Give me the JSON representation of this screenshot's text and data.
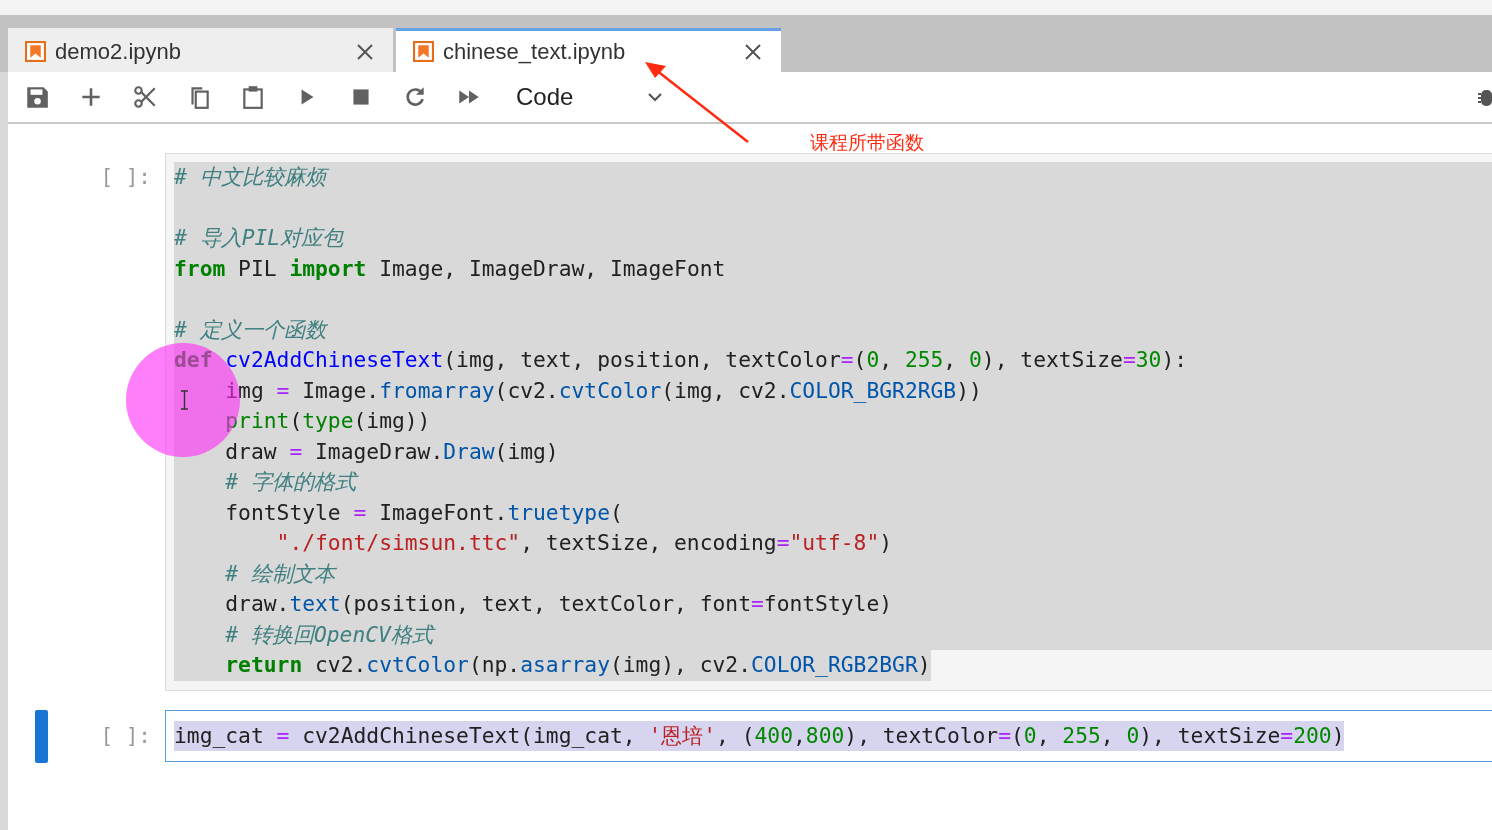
{
  "tabs": [
    {
      "label": "demo2.ipynb",
      "selected": false
    },
    {
      "label": "chinese_text.ipynb",
      "selected": true
    }
  ],
  "toolbar": {
    "cell_type": "Code"
  },
  "annotation": {
    "text": "课程所带函数"
  },
  "cells": [
    {
      "prompt": "[ ]:",
      "active": false,
      "selected": true,
      "lines": [
        {
          "kind": "code",
          "tokens": [
            {
              "kind": "comment",
              "text": "# 中文比较麻烦"
            }
          ]
        },
        {
          "kind": "blank"
        },
        {
          "kind": "code",
          "tokens": [
            {
              "kind": "comment",
              "text": "# 导入PIL对应包"
            }
          ]
        },
        {
          "kind": "code",
          "tokens": [
            {
              "kind": "keyword",
              "text": "from"
            },
            {
              "kind": "plain",
              "text": " PIL "
            },
            {
              "kind": "keyword",
              "text": "import"
            },
            {
              "kind": "plain",
              "text": " Image, ImageDraw, ImageFont"
            }
          ]
        },
        {
          "kind": "blank"
        },
        {
          "kind": "code",
          "tokens": [
            {
              "kind": "comment",
              "text": "# 定义一个函数"
            }
          ]
        },
        {
          "kind": "code",
          "tokens": [
            {
              "kind": "keyword",
              "text": "def"
            },
            {
              "kind": "defname",
              "text": " cv2AddChineseText"
            },
            {
              "kind": "plain",
              "text": "(img, text, position, textColor"
            },
            {
              "kind": "operator",
              "text": "="
            },
            {
              "kind": "plain",
              "text": "("
            },
            {
              "kind": "number",
              "text": "0"
            },
            {
              "kind": "plain",
              "text": ", "
            },
            {
              "kind": "number",
              "text": "255"
            },
            {
              "kind": "plain",
              "text": ", "
            },
            {
              "kind": "number",
              "text": "0"
            },
            {
              "kind": "plain",
              "text": "), textSize"
            },
            {
              "kind": "operator",
              "text": "="
            },
            {
              "kind": "number",
              "text": "30"
            },
            {
              "kind": "plain",
              "text": "):"
            }
          ]
        },
        {
          "kind": "body",
          "tokens": [
            {
              "kind": "plain",
              "text": "img "
            },
            {
              "kind": "operator",
              "text": "="
            },
            {
              "kind": "plain",
              "text": " Image."
            },
            {
              "kind": "attribute",
              "text": "fromarray"
            },
            {
              "kind": "plain",
              "text": "(cv2."
            },
            {
              "kind": "attribute",
              "text": "cvtColor"
            },
            {
              "kind": "plain",
              "text": "(img, cv2."
            },
            {
              "kind": "attribute",
              "text": "COLOR_BGR2RGB"
            },
            {
              "kind": "plain",
              "text": "))"
            }
          ]
        },
        {
          "kind": "body",
          "tokens": [
            {
              "kind": "builtin",
              "text": "print"
            },
            {
              "kind": "plain",
              "text": "("
            },
            {
              "kind": "builtin",
              "text": "type"
            },
            {
              "kind": "plain",
              "text": "(img))"
            }
          ]
        },
        {
          "kind": "body",
          "tokens": [
            {
              "kind": "plain",
              "text": "draw "
            },
            {
              "kind": "operator",
              "text": "="
            },
            {
              "kind": "plain",
              "text": " ImageDraw."
            },
            {
              "kind": "attribute",
              "text": "Draw"
            },
            {
              "kind": "plain",
              "text": "(img)"
            }
          ]
        },
        {
          "kind": "body",
          "tokens": [
            {
              "kind": "comment",
              "text": "# 字体的格式"
            }
          ]
        },
        {
          "kind": "body",
          "tokens": [
            {
              "kind": "plain",
              "text": "fontStyle "
            },
            {
              "kind": "operator",
              "text": "="
            },
            {
              "kind": "plain",
              "text": " ImageFont."
            },
            {
              "kind": "attribute",
              "text": "truetype"
            },
            {
              "kind": "plain",
              "text": "("
            }
          ]
        },
        {
          "kind": "continuation",
          "tokens": [
            {
              "kind": "string",
              "text": "\"./font/simsun.ttc\""
            },
            {
              "kind": "plain",
              "text": ", textSize, encoding"
            },
            {
              "kind": "operator",
              "text": "="
            },
            {
              "kind": "string",
              "text": "\"utf-8\""
            },
            {
              "kind": "plain",
              "text": ")"
            }
          ]
        },
        {
          "kind": "body",
          "tokens": [
            {
              "kind": "comment",
              "text": "# 绘制文本"
            }
          ]
        },
        {
          "kind": "body",
          "tokens": [
            {
              "kind": "plain",
              "text": "draw."
            },
            {
              "kind": "attribute",
              "text": "text"
            },
            {
              "kind": "plain",
              "text": "(position, text, textColor, font"
            },
            {
              "kind": "operator",
              "text": "="
            },
            {
              "kind": "plain",
              "text": "fontStyle)"
            }
          ]
        },
        {
          "kind": "body",
          "tokens": [
            {
              "kind": "comment",
              "text": "# 转换回OpenCV格式"
            }
          ]
        },
        {
          "kind": "body",
          "tokens": [
            {
              "kind": "keyword",
              "text": "return"
            },
            {
              "kind": "plain",
              "text": " cv2."
            },
            {
              "kind": "attribute",
              "text": "cvtColor"
            },
            {
              "kind": "plain",
              "text": "(np."
            },
            {
              "kind": "attribute",
              "text": "asarray"
            },
            {
              "kind": "plain",
              "text": "(img), cv2."
            },
            {
              "kind": "attribute",
              "text": "COLOR_RGB2BGR"
            },
            {
              "kind": "plain",
              "text": ")"
            }
          ]
        }
      ]
    },
    {
      "prompt": "[ ]:",
      "active": true,
      "selected": true,
      "lines": [
        {
          "kind": "code",
          "tokens": [
            {
              "kind": "plain",
              "text": "img_cat "
            },
            {
              "kind": "operator",
              "text": "="
            },
            {
              "kind": "plain",
              "text": " cv2AddChineseText(img_cat, "
            },
            {
              "kind": "string",
              "text": "'恩培'"
            },
            {
              "kind": "plain",
              "text": ", ("
            },
            {
              "kind": "number",
              "text": "400"
            },
            {
              "kind": "plain",
              "text": ","
            },
            {
              "kind": "number",
              "text": "800"
            },
            {
              "kind": "plain",
              "text": "), textColor"
            },
            {
              "kind": "operator",
              "text": "="
            },
            {
              "kind": "plain",
              "text": "("
            },
            {
              "kind": "number",
              "text": "0"
            },
            {
              "kind": "plain",
              "text": ", "
            },
            {
              "kind": "number",
              "text": "255"
            },
            {
              "kind": "plain",
              "text": ", "
            },
            {
              "kind": "number",
              "text": "0"
            },
            {
              "kind": "plain",
              "text": "), textSize"
            },
            {
              "kind": "operator",
              "text": "="
            },
            {
              "kind": "number",
              "text": "200"
            },
            {
              "kind": "plain",
              "text": ")"
            }
          ]
        }
      ]
    }
  ]
}
